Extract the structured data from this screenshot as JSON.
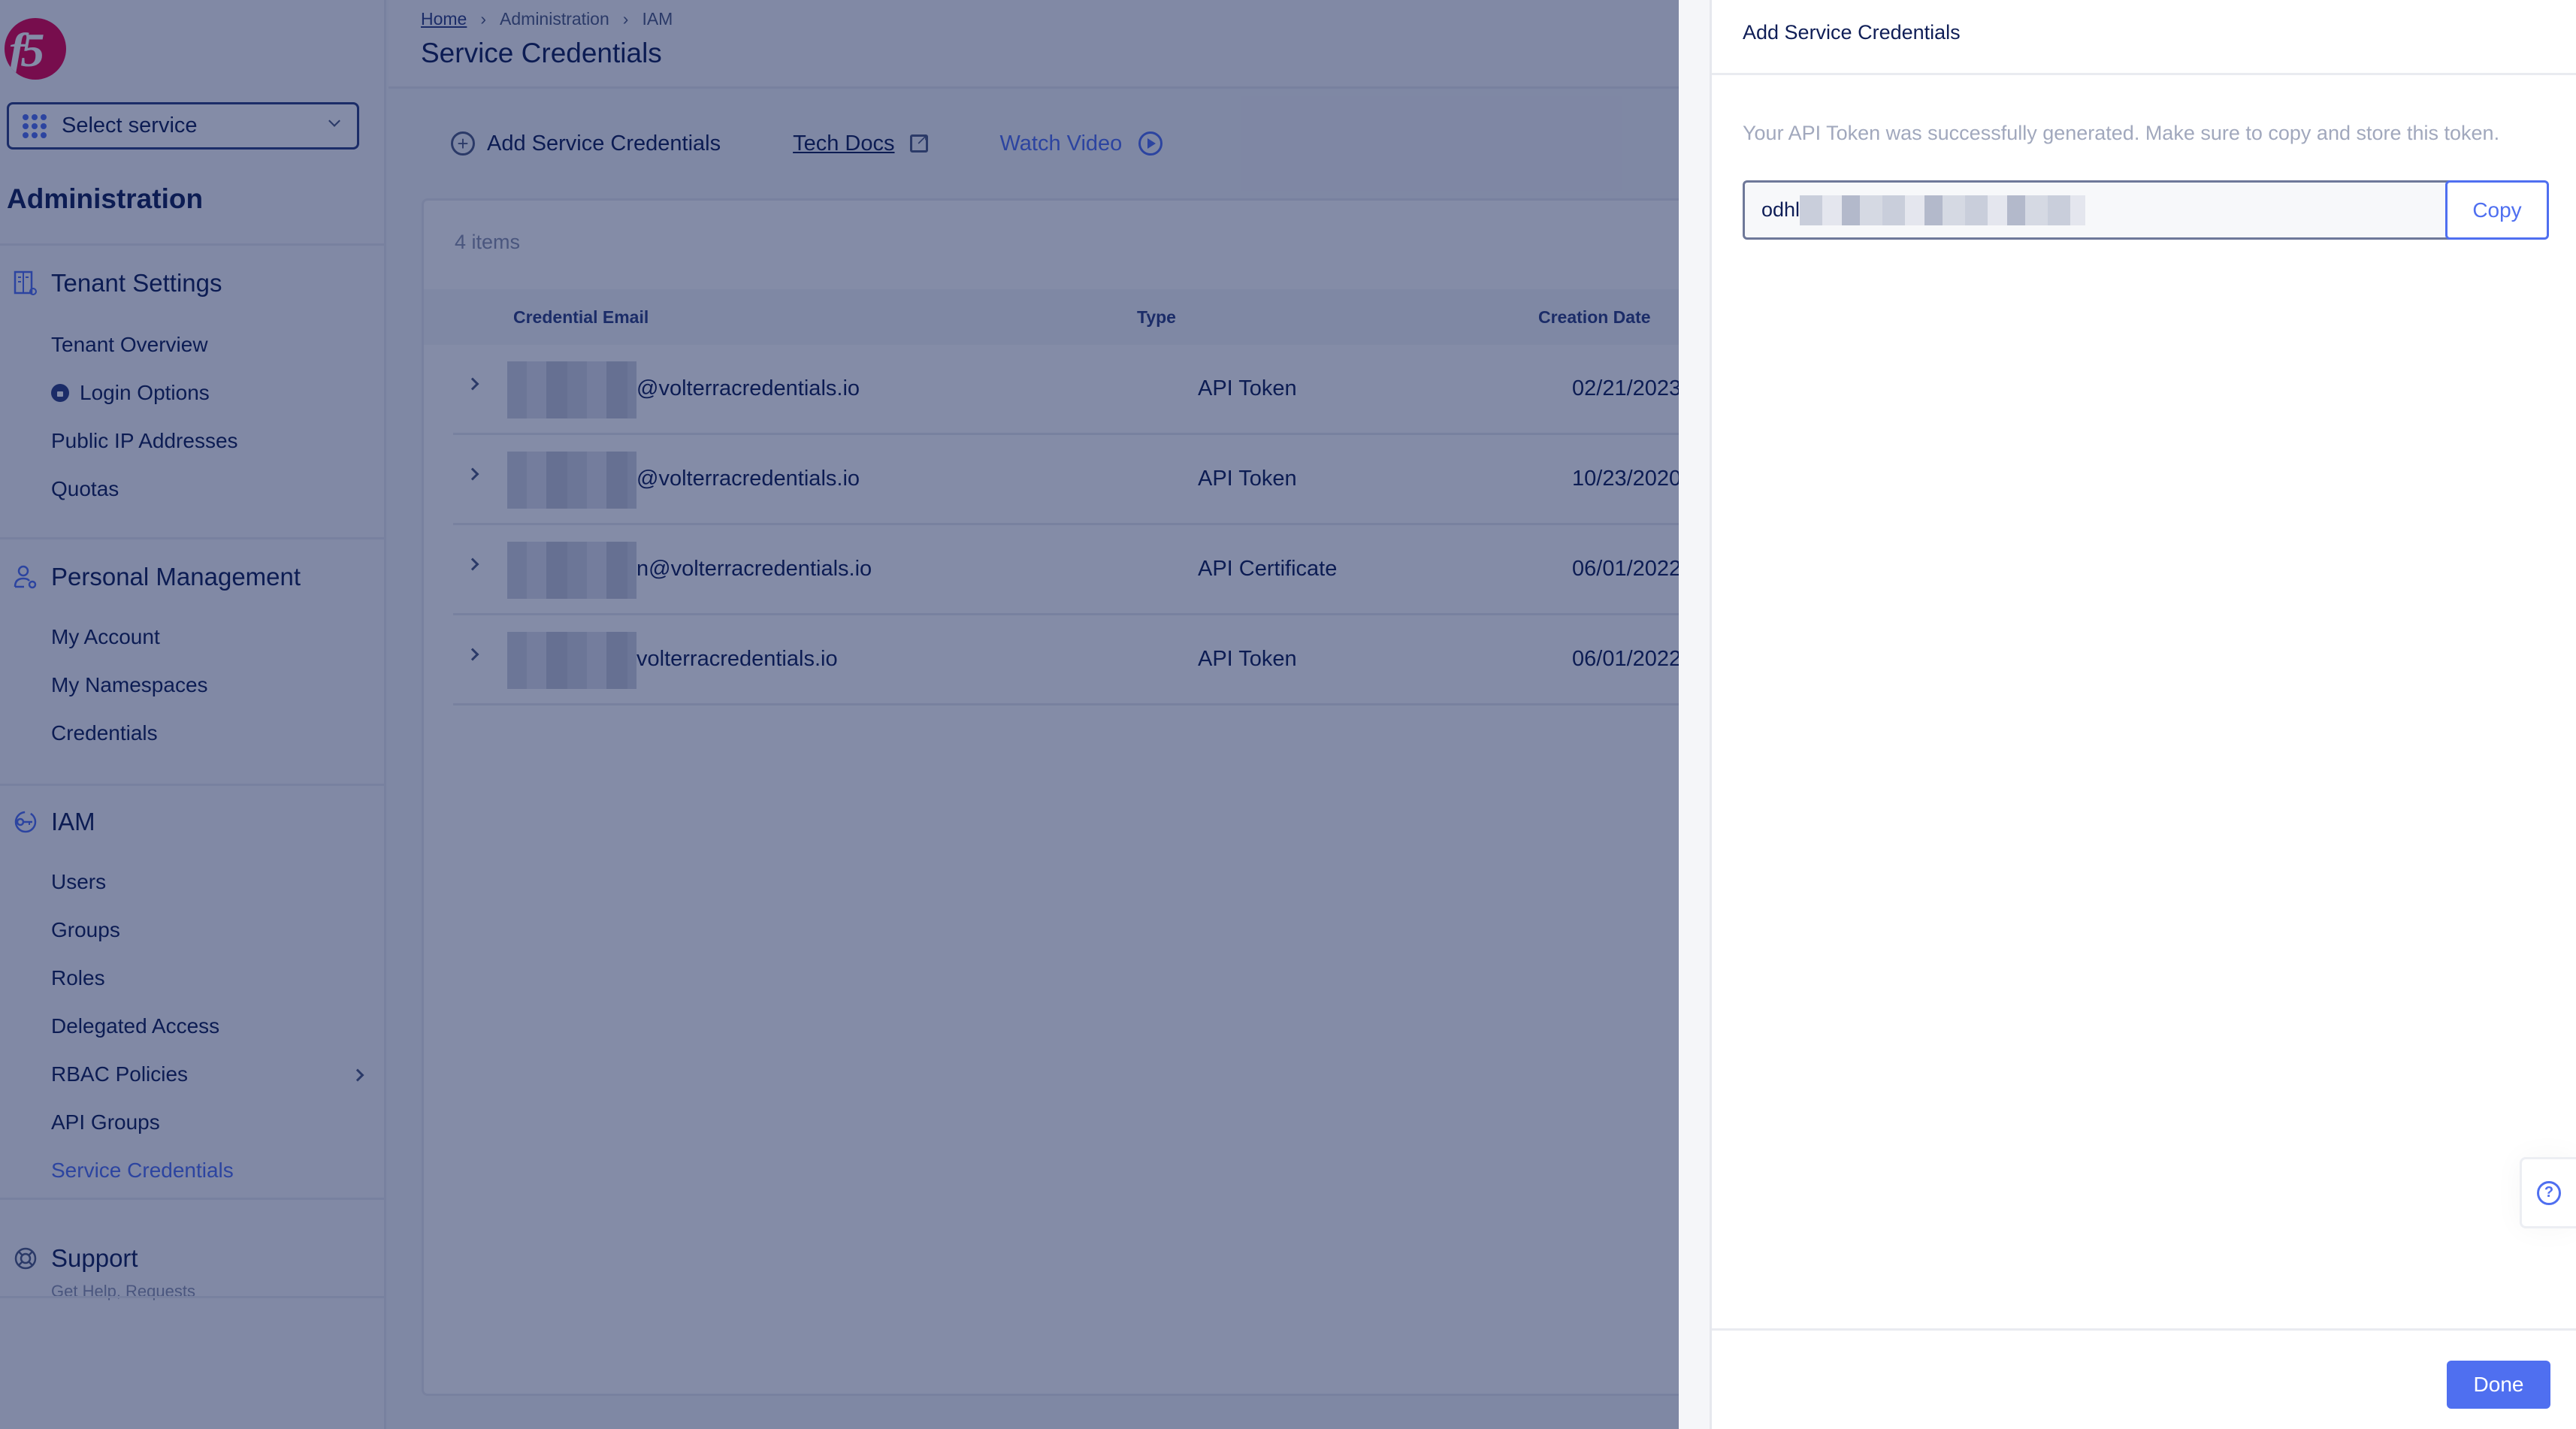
{
  "logo": {
    "text": "f5"
  },
  "sidebar": {
    "service_select": {
      "label": "Select service",
      "icon": "grid-icon"
    },
    "title": "Administration",
    "sections": [
      {
        "label": "Tenant Settings",
        "icon": "tenant-settings-icon",
        "items": [
          {
            "label": "Tenant Overview"
          },
          {
            "label": "Login Options",
            "icon": "lock-icon"
          },
          {
            "label": "Public IP Addresses"
          },
          {
            "label": "Quotas"
          }
        ]
      },
      {
        "label": "Personal Management",
        "icon": "user-gear-icon",
        "items": [
          {
            "label": "My Account"
          },
          {
            "label": "My Namespaces"
          },
          {
            "label": "Credentials"
          }
        ]
      },
      {
        "label": "IAM",
        "icon": "key-icon",
        "items": [
          {
            "label": "Users"
          },
          {
            "label": "Groups"
          },
          {
            "label": "Roles"
          },
          {
            "label": "Delegated Access"
          },
          {
            "label": "RBAC Policies",
            "has_submenu": true
          },
          {
            "label": "API Groups"
          },
          {
            "label": "Service Credentials",
            "active": true
          }
        ]
      },
      {
        "label": "Support",
        "icon": "lifebuoy-icon",
        "subtitle": "Get Help, Requests"
      }
    ]
  },
  "header": {
    "breadcrumbs": [
      "Home",
      "Administration",
      "IAM"
    ],
    "title": "Service Credentials"
  },
  "toolbar": {
    "add_label": "Add Service Credentials",
    "docs_label": "Tech Docs",
    "video_label": "Watch Video"
  },
  "table": {
    "count_label": "4 items",
    "columns": [
      "Credential Email",
      "Type",
      "Creation Date"
    ],
    "rows": [
      {
        "email": "@volterracredentials.io",
        "type": "API Token",
        "date": "02/21/2023"
      },
      {
        "email": "@volterracredentials.io",
        "type": "API Token",
        "date": "10/23/2020"
      },
      {
        "email": "n@volterracredentials.io",
        "type": "API Certificate",
        "date": "06/01/2022"
      },
      {
        "email": "volterracredentials.io",
        "type": "API Token",
        "date": "06/01/2022"
      }
    ]
  },
  "drawer": {
    "title": "Add Service Credentials",
    "message": "Your API Token was successfully generated. Make sure to copy and store this token.",
    "token_prefix": "odhl",
    "copy_label": "Copy",
    "done_label": "Done",
    "help_icon": "question-circle-icon"
  },
  "colors": {
    "accent": "#4f6ff0",
    "text_primary": "#0f1e57",
    "overlay": "rgba(10,25,80,0.5)"
  }
}
